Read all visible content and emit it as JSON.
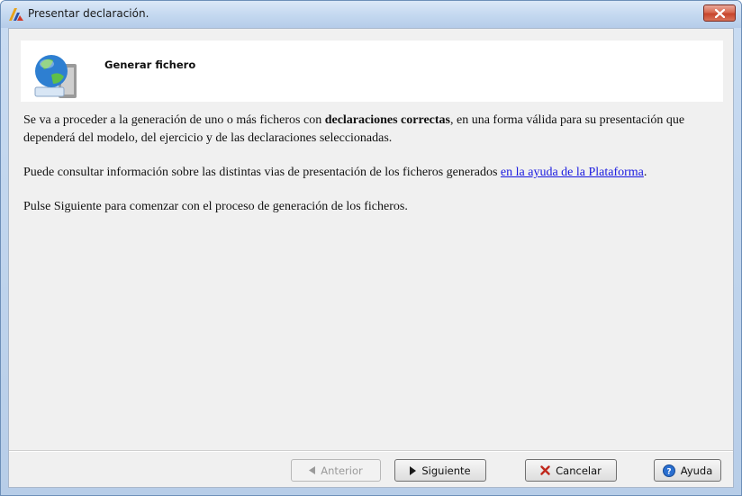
{
  "window": {
    "title": "Presentar declaración."
  },
  "header": {
    "title": "Generar fichero"
  },
  "content": {
    "p1_a": "Se va a proceder a la generación de uno o más ficheros con ",
    "p1_bold": "declaraciones correctas",
    "p1_b": ", en una forma válida para su presentación que dependerá del modelo, del ejercicio y de las declaraciones seleccionadas.",
    "p2_a": "Puede consultar información sobre las distintas vias de presentación de los ficheros generados ",
    "p2_link": "en la ayuda de la Plataforma",
    "p2_b": ".",
    "p3": "Pulse Siguiente para comenzar con el proceso de generación de los ficheros."
  },
  "buttons": {
    "anterior": "Anterior",
    "siguiente": "Siguiente",
    "cancelar": "Cancelar",
    "ayuda": "Ayuda"
  }
}
